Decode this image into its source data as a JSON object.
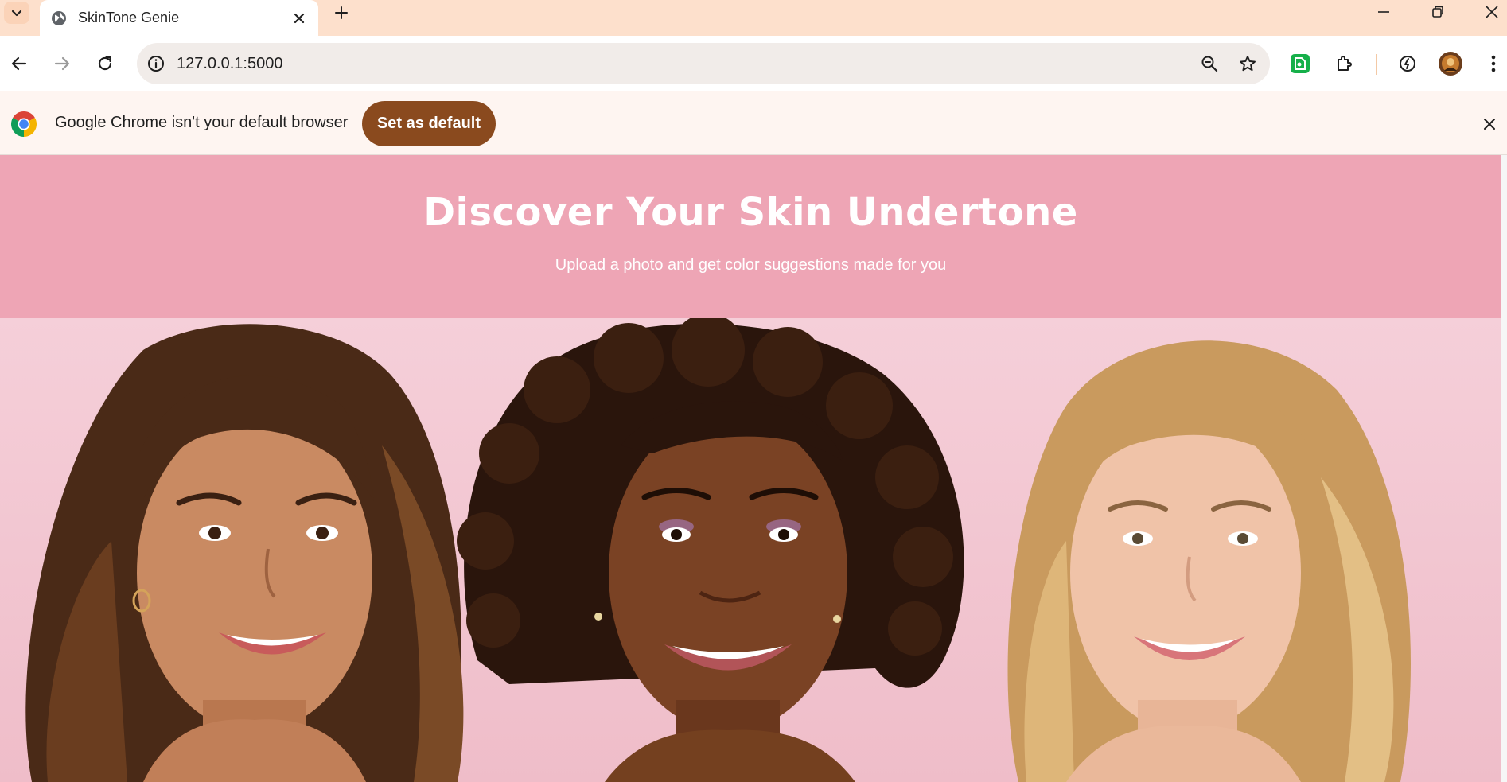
{
  "browser": {
    "tab": {
      "title": "SkinTone Genie"
    },
    "address_bar": {
      "url": "127.0.0.1:5000"
    },
    "accent": "#fde0cc"
  },
  "infobar": {
    "message": "Google Chrome isn't your default browser",
    "button_label": "Set as default",
    "button_color": "#8a4a1e"
  },
  "hero": {
    "title": "Discover Your Skin Undertone",
    "subtitle": "Upload a photo and get color suggestions made for you",
    "background": "#eea5b5"
  },
  "banner_image": {
    "icons": [
      "woman-portrait-medium-skin",
      "woman-portrait-deep-skin",
      "woman-portrait-fair-skin"
    ]
  }
}
